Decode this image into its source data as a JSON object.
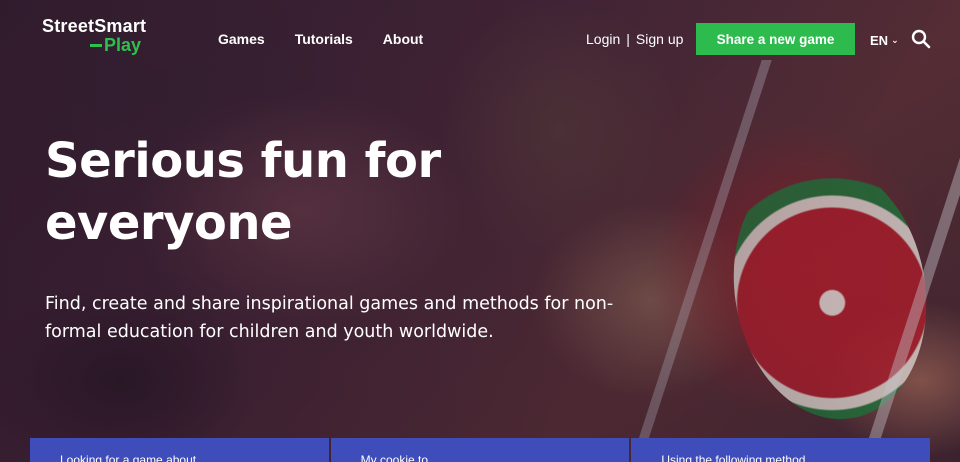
{
  "header": {
    "logo": {
      "line1": "StreetSmart",
      "line2": "Play"
    },
    "nav": [
      "Games",
      "Tutorials",
      "About"
    ],
    "auth": {
      "login": "Login",
      "separator": "|",
      "signup": "Sign up"
    },
    "cta": "Share a new game",
    "language": "EN",
    "icons": {
      "language_dropdown": "chevron-down-icon",
      "search": "search-icon"
    }
  },
  "hero": {
    "title": "Serious fun for everyone",
    "subtitle": "Find, create and share inspirational games and methods for non-formal education for children and youth worldwide."
  },
  "cards": [
    "Looking for a game about…",
    "My cookie to…",
    "Using the following method…"
  ],
  "colors": {
    "brand_green": "#2dbb4e",
    "card_blue": "#3f4dbb"
  }
}
